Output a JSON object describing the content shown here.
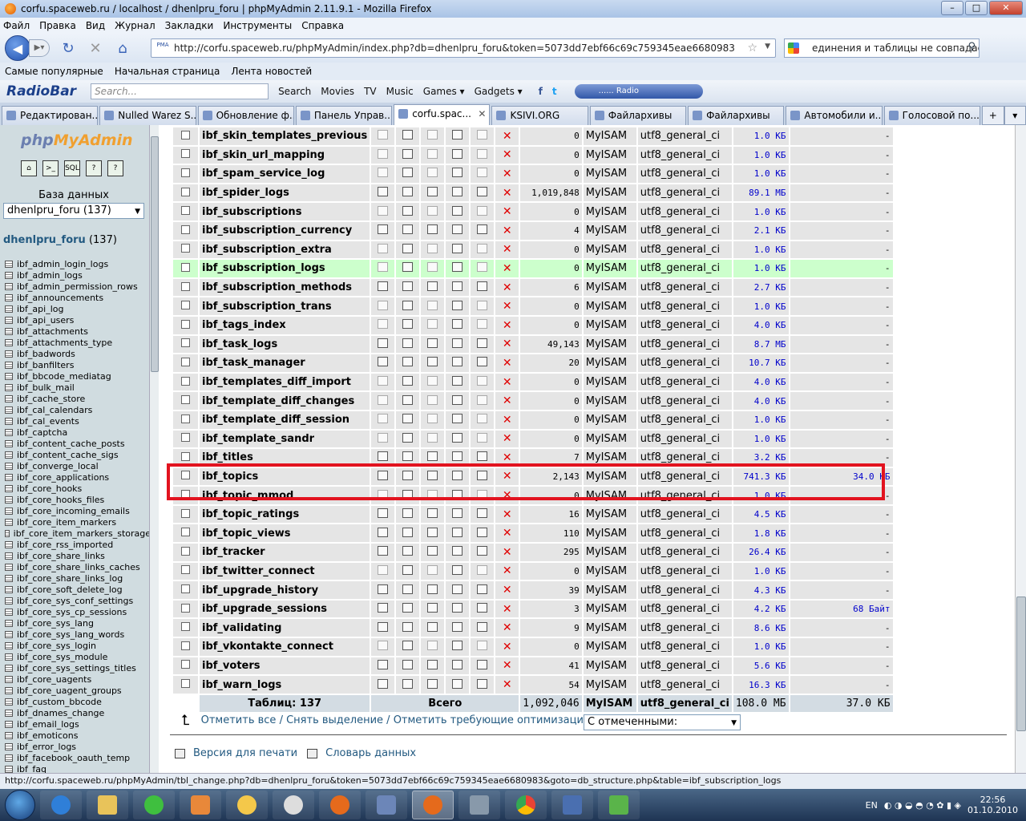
{
  "window": {
    "title": "corfu.spaceweb.ru / localhost / dhenlpru_foru | phpMyAdmin 2.11.9.1 - Mozilla Firefox"
  },
  "menu": [
    "Файл",
    "Правка",
    "Вид",
    "Журнал",
    "Закладки",
    "Инструменты",
    "Справка"
  ],
  "url": "http://corfu.spaceweb.ru/phpMyAdmin/index.php?db=dhenlpru_foru&token=5073dd7ebf66c69c759345eae6680983",
  "search_value": "единения и таблицы не совпадает:",
  "bookmarks": [
    "Самые популярные",
    "Начальная страница",
    "Лента новостей"
  ],
  "radiobar": {
    "logo": "RadioBar",
    "search_placeholder": "Search...",
    "items": [
      "Search",
      "Movies",
      "TV",
      "Music",
      "Games ▾",
      "Gadgets ▾"
    ],
    "radio_label": "...... Radio"
  },
  "tabs": [
    "Редактирован...",
    "Nulled Warez S...",
    "Обновление ф...",
    "Панель Управ...",
    "corfu.spac...",
    "KSIVI.ORG",
    "Файлархивы",
    "Файлархивы",
    "Автомобили и...",
    "Голосовой по..."
  ],
  "sidebar": {
    "logo_php": "php",
    "logo_my": "MyAdmin",
    "db_label": "База данных",
    "db_select": "dhenlpru_foru (137)",
    "db_link": "dhenlpru_foru",
    "db_count": "(137)",
    "tables": [
      "ibf_admin_login_logs",
      "ibf_admin_logs",
      "ibf_admin_permission_rows",
      "ibf_announcements",
      "ibf_api_log",
      "ibf_api_users",
      "ibf_attachments",
      "ibf_attachments_type",
      "ibf_badwords",
      "ibf_banfilters",
      "ibf_bbcode_mediatag",
      "ibf_bulk_mail",
      "ibf_cache_store",
      "ibf_cal_calendars",
      "ibf_cal_events",
      "ibf_captcha",
      "ibf_content_cache_posts",
      "ibf_content_cache_sigs",
      "ibf_converge_local",
      "ibf_core_applications",
      "ibf_core_hooks",
      "ibf_core_hooks_files",
      "ibf_core_incoming_emails",
      "ibf_core_item_markers",
      "ibf_core_item_markers_storage",
      "ibf_core_rss_imported",
      "ibf_core_share_links",
      "ibf_core_share_links_caches",
      "ibf_core_share_links_log",
      "ibf_core_soft_delete_log",
      "ibf_core_sys_conf_settings",
      "ibf_core_sys_cp_sessions",
      "ibf_core_sys_lang",
      "ibf_core_sys_lang_words",
      "ibf_core_sys_login",
      "ibf_core_sys_module",
      "ibf_core_sys_settings_titles",
      "ibf_core_uagents",
      "ibf_core_uagent_groups",
      "ibf_custom_bbcode",
      "ibf_dnames_change",
      "ibf_email_logs",
      "ibf_emoticons",
      "ibf_error_logs",
      "ibf_facebook_oauth_temp",
      "ibf_faq"
    ]
  },
  "rows": [
    {
      "name": "ibf_skin_templates_previous",
      "rows": "0",
      "engine": "MyISAM",
      "collation": "utf8_general_ci",
      "size": "1.0 КБ",
      "overhead": "-"
    },
    {
      "name": "ibf_skin_url_mapping",
      "rows": "0",
      "engine": "MyISAM",
      "collation": "utf8_general_ci",
      "size": "1.0 КБ",
      "overhead": "-"
    },
    {
      "name": "ibf_spam_service_log",
      "rows": "0",
      "engine": "MyISAM",
      "collation": "utf8_general_ci",
      "size": "1.0 КБ",
      "overhead": "-"
    },
    {
      "name": "ibf_spider_logs",
      "rows": "1,019,848",
      "engine": "MyISAM",
      "collation": "utf8_general_ci",
      "size": "89.1 МБ",
      "overhead": "-"
    },
    {
      "name": "ibf_subscriptions",
      "rows": "0",
      "engine": "MyISAM",
      "collation": "utf8_general_ci",
      "size": "1.0 КБ",
      "overhead": "-"
    },
    {
      "name": "ibf_subscription_currency",
      "rows": "4",
      "engine": "MyISAM",
      "collation": "utf8_general_ci",
      "size": "2.1 КБ",
      "overhead": "-"
    },
    {
      "name": "ibf_subscription_extra",
      "rows": "0",
      "engine": "MyISAM",
      "collation": "utf8_general_ci",
      "size": "1.0 КБ",
      "overhead": "-"
    },
    {
      "name": "ibf_subscription_logs",
      "rows": "0",
      "engine": "MyISAM",
      "collation": "utf8_general_ci",
      "size": "1.0 КБ",
      "overhead": "-",
      "highlight": true
    },
    {
      "name": "ibf_subscription_methods",
      "rows": "6",
      "engine": "MyISAM",
      "collation": "utf8_general_ci",
      "size": "2.7 КБ",
      "overhead": "-"
    },
    {
      "name": "ibf_subscription_trans",
      "rows": "0",
      "engine": "MyISAM",
      "collation": "utf8_general_ci",
      "size": "1.0 КБ",
      "overhead": "-"
    },
    {
      "name": "ibf_tags_index",
      "rows": "0",
      "engine": "MyISAM",
      "collation": "utf8_general_ci",
      "size": "4.0 КБ",
      "overhead": "-"
    },
    {
      "name": "ibf_task_logs",
      "rows": "49,143",
      "engine": "MyISAM",
      "collation": "utf8_general_ci",
      "size": "8.7 МБ",
      "overhead": "-"
    },
    {
      "name": "ibf_task_manager",
      "rows": "20",
      "engine": "MyISAM",
      "collation": "utf8_general_ci",
      "size": "10.7 КБ",
      "overhead": "-"
    },
    {
      "name": "ibf_templates_diff_import",
      "rows": "0",
      "engine": "MyISAM",
      "collation": "utf8_general_ci",
      "size": "4.0 КБ",
      "overhead": "-"
    },
    {
      "name": "ibf_template_diff_changes",
      "rows": "0",
      "engine": "MyISAM",
      "collation": "utf8_general_ci",
      "size": "4.0 КБ",
      "overhead": "-"
    },
    {
      "name": "ibf_template_diff_session",
      "rows": "0",
      "engine": "MyISAM",
      "collation": "utf8_general_ci",
      "size": "1.0 КБ",
      "overhead": "-"
    },
    {
      "name": "ibf_template_sandr",
      "rows": "0",
      "engine": "MyISAM",
      "collation": "utf8_general_ci",
      "size": "1.0 КБ",
      "overhead": "-"
    },
    {
      "name": "ibf_titles",
      "rows": "7",
      "engine": "MyISAM",
      "collation": "utf8_general_ci",
      "size": "3.2 КБ",
      "overhead": "-"
    },
    {
      "name": "ibf_topics",
      "rows": "2,143",
      "engine": "MyISAM",
      "collation": "utf8_general_ci",
      "size": "741.3 КБ",
      "overhead": "34.0 КБ"
    },
    {
      "name": "ibf_topic_mmod",
      "rows": "0",
      "engine": "MyISAM",
      "collation": "utf8_general_ci",
      "size": "1.0 КБ",
      "overhead": "-"
    },
    {
      "name": "ibf_topic_ratings",
      "rows": "16",
      "engine": "MyISAM",
      "collation": "utf8_general_ci",
      "size": "4.5 КБ",
      "overhead": "-"
    },
    {
      "name": "ibf_topic_views",
      "rows": "110",
      "engine": "MyISAM",
      "collation": "utf8_general_ci",
      "size": "1.8 КБ",
      "overhead": "-"
    },
    {
      "name": "ibf_tracker",
      "rows": "295",
      "engine": "MyISAM",
      "collation": "utf8_general_ci",
      "size": "26.4 КБ",
      "overhead": "-"
    },
    {
      "name": "ibf_twitter_connect",
      "rows": "0",
      "engine": "MyISAM",
      "collation": "utf8_general_ci",
      "size": "1.0 КБ",
      "overhead": "-"
    },
    {
      "name": "ibf_upgrade_history",
      "rows": "39",
      "engine": "MyISAM",
      "collation": "utf8_general_ci",
      "size": "4.3 КБ",
      "overhead": "-"
    },
    {
      "name": "ibf_upgrade_sessions",
      "rows": "3",
      "engine": "MyISAM",
      "collation": "utf8_general_ci",
      "size": "4.2 КБ",
      "overhead": "68 Байт"
    },
    {
      "name": "ibf_validating",
      "rows": "9",
      "engine": "MyISAM",
      "collation": "utf8_general_ci",
      "size": "8.6 КБ",
      "overhead": "-"
    },
    {
      "name": "ibf_vkontakte_connect",
      "rows": "0",
      "engine": "MyISAM",
      "collation": "utf8_general_ci",
      "size": "1.0 КБ",
      "overhead": "-"
    },
    {
      "name": "ibf_voters",
      "rows": "41",
      "engine": "MyISAM",
      "collation": "utf8_general_ci",
      "size": "5.6 КБ",
      "overhead": "-"
    },
    {
      "name": "ibf_warn_logs",
      "rows": "54",
      "engine": "MyISAM",
      "collation": "utf8_general_ci",
      "size": "16.3 КБ",
      "overhead": "-"
    }
  ],
  "footer": {
    "tables": "Таблиц: 137",
    "total_label": "Всего",
    "rows": "1,092,046",
    "engine": "MyISAM",
    "collation": "utf8_general_ci",
    "size": "108.0 МБ",
    "overhead": "37.0 КБ"
  },
  "actions": {
    "check_all": "Отметить все",
    "uncheck_all": "Снять выделение",
    "check_overhead": "Отметить требующие оптимизации",
    "with_selected": "С отмеченными:"
  },
  "print_view": "Версия для печати",
  "data_dictionary": "Словарь данных",
  "status": "http://corfu.spaceweb.ru/phpMyAdmin/tbl_change.php?db=dhenlpru_foru&token=5073dd7ebf66c69c759345eae6680983&goto=db_structure.php&table=ibf_subscription_logs",
  "tray": {
    "lang": "EN",
    "time": "22:56",
    "date": "01.10.2010"
  }
}
